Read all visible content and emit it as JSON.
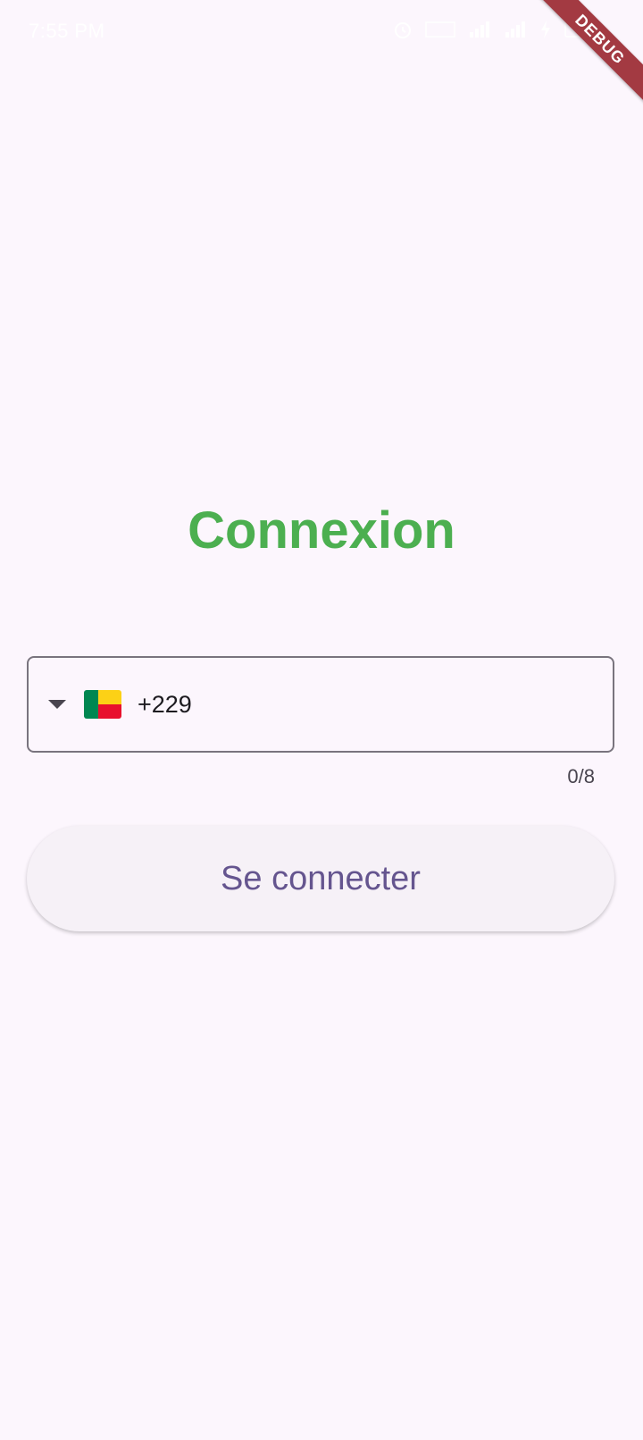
{
  "status_bar": {
    "time": "7:55 PM",
    "icons": [
      "alarm-icon",
      "volte-icon",
      "signal-icon",
      "signal-icon",
      "charging-icon",
      "battery-icon"
    ]
  },
  "debug_banner": {
    "label": "DEBUG",
    "color": "#a33a42"
  },
  "title": "Connexion",
  "phone_field": {
    "country_flag": "benin-flag-icon",
    "dial_code": "+229",
    "value": "",
    "counter": "0/8"
  },
  "connect_button": {
    "label": "Se connecter"
  },
  "colors": {
    "background": "#fcf6fd",
    "title": "#4caf50",
    "button_text": "#65558f",
    "button_bg": "#f6f1f7"
  }
}
